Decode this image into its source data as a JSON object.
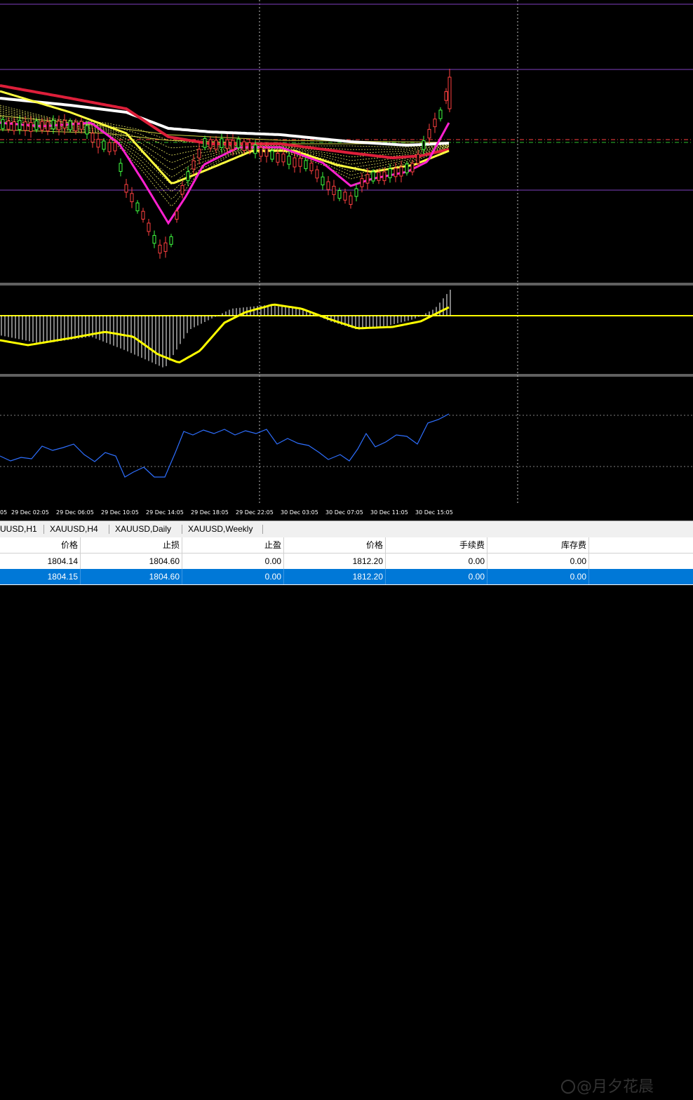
{
  "time_axis": {
    "labels": [
      "05",
      "29 Dec 02:05",
      "29 Dec 06:05",
      "29 Dec 10:05",
      "29 Dec 14:05",
      "29 Dec 18:05",
      "29 Dec 22:05",
      "30 Dec 03:05",
      "30 Dec 07:05",
      "30 Dec 11:05",
      "30 Dec 15:05"
    ]
  },
  "tabs": [
    "UUSD,H1",
    "XAUUSD,H4",
    "XAUUSD,Daily",
    "XAUUSD,Weekly"
  ],
  "orders": {
    "columns": [
      "价格",
      "止损",
      "止盈",
      "价格",
      "手续费",
      "库存费"
    ],
    "rows": [
      [
        "1804.14",
        "1804.60",
        "0.00",
        "1812.20",
        "0.00",
        "0.00"
      ],
      [
        "1804.15",
        "1804.60",
        "0.00",
        "1812.20",
        "0.00",
        "0.00"
      ]
    ]
  },
  "watermark": "@月夕花晨",
  "colors": {
    "background": "#000000",
    "bull_candle": "#ff4040",
    "bear_candle": "#40ff40",
    "ma_white": "#ffffff",
    "ma_red": "#dd1f3a",
    "ma_yellow": "#ffff40",
    "ma_magenta": "#ff20d0",
    "macd_signal": "#ffff00",
    "rsi_line": "#2e6fff",
    "selected_row": "#0078d7"
  }
}
